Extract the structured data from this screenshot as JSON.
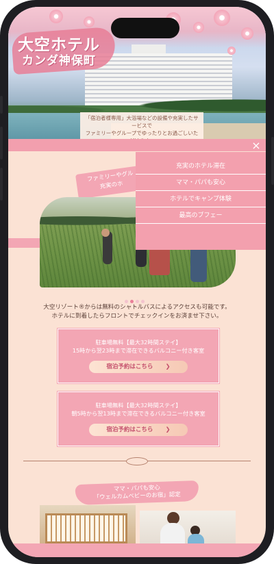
{
  "hero": {
    "logo_title": "大空ホテル",
    "logo_subtitle": "カンダ神保町",
    "caption_line1": "「宿泊者様専用」大浴場などの設備や充実したサービスで",
    "caption_line2": "ファミリーやグループでゆったりとお過ごしいただけます。"
  },
  "nav": {
    "close_label": "×",
    "menu_items": [
      {
        "label": "充実のホテル滞在"
      },
      {
        "label": "ママ・パパも安心"
      },
      {
        "label": "ホテルでキャンプ体験"
      },
      {
        "label": "最高のブフェー"
      }
    ]
  },
  "section1": {
    "ribbon_line1": "ファミリーやグル",
    "ribbon_line2": "充実のホ",
    "carousel_pages": 4,
    "carousel_active": 2
  },
  "intro": {
    "line1": "大空リゾート®からは無料のシャトルバスによるアクセスも可能です。",
    "line2": "ホテルに到着したらフロントでチェックインをお済ませ下さい。"
  },
  "offers": [
    {
      "line1": "駐車場無料【最大32時間ステイ】",
      "line2": "15時から翌23時まで滞在できるバルコニー付き客室",
      "button": "宿泊予約はこちら",
      "chevron": "❯"
    },
    {
      "line1": "駐車場無料【最大32時間ステイ】",
      "line2": "朝5時から翌13時まで滞在できるバルコニー付き客室",
      "button": "宿泊予約はこちら",
      "chevron": "❯"
    }
  ],
  "section2": {
    "ribbon_line1": "ママ・パパも安心",
    "ribbon_line2": "「ウェルカムベビーのお宿」認定"
  },
  "colors": {
    "pink": "#f3a6b4",
    "background": "#fbe2d4",
    "text": "#5b4038"
  }
}
